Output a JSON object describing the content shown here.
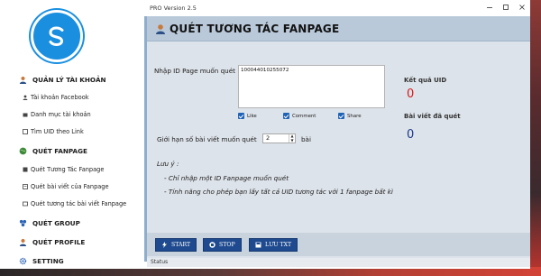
{
  "window": {
    "title": "PRO Version 2.5"
  },
  "sidebar": {
    "sections": [
      {
        "label": "QUẢN LÝ TÀI KHOẢN",
        "icon": "user-icon",
        "items": [
          {
            "label": "Tài khoản Facebook",
            "icon": "user-icon"
          },
          {
            "label": "Danh mục tài khoản",
            "icon": "folder-icon"
          },
          {
            "label": "Tìm UID theo Link",
            "icon": "link-icon"
          }
        ]
      },
      {
        "label": "QUÉT FANPAGE",
        "icon": "globe-icon",
        "items": [
          {
            "label": "Quét Tương Tác Fanpage",
            "icon": "flag-icon"
          },
          {
            "label": "Quét bài viết của Fanpage",
            "icon": "document-icon"
          },
          {
            "label": "Quét tương tác bài viết Fanpage",
            "icon": "comment-icon"
          }
        ]
      },
      {
        "label": "QUÉT GROUP",
        "icon": "group-icon",
        "items": []
      },
      {
        "label": "QUÉT PROFILE",
        "icon": "profile-icon",
        "items": []
      },
      {
        "label": "SETTING",
        "icon": "gear-icon",
        "items": []
      }
    ]
  },
  "page": {
    "title": "QUÉT TƯƠNG TÁC FANPAGE",
    "id_label": "Nhập ID Page muốn quét",
    "id_value": "100044010255072",
    "checkboxes": [
      {
        "label": "Like",
        "checked": true
      },
      {
        "label": "Comment",
        "checked": true
      },
      {
        "label": "Share",
        "checked": true
      }
    ],
    "limit_label": "Giới hạn số bài viết muốn quét",
    "limit_value": "2",
    "limit_unit": "bài",
    "result_uid_label": "Kết quả UID",
    "result_uid_value": "0",
    "result_posts_label": "Bài viết đã quét",
    "result_posts_value": "0",
    "note_title": "Lưu ý :",
    "note_lines": [
      "- Chỉ nhập một ID Fanpage muốn quét",
      "- Tính năng cho phép bạn lấy tất cả UID tương tác với 1 fanpage bất kì"
    ]
  },
  "actions": {
    "start": "START",
    "stop": "STOP",
    "save": "LƯU TXT"
  },
  "status": {
    "label": "Status"
  },
  "colors": {
    "accent": "#1f4a8f",
    "header_bg": "#b9c9da",
    "panel_bg": "#dde3ea",
    "result_red": "#d31d1d",
    "result_blue": "#1f3a8a",
    "logo_blue": "#1a8fe0"
  }
}
